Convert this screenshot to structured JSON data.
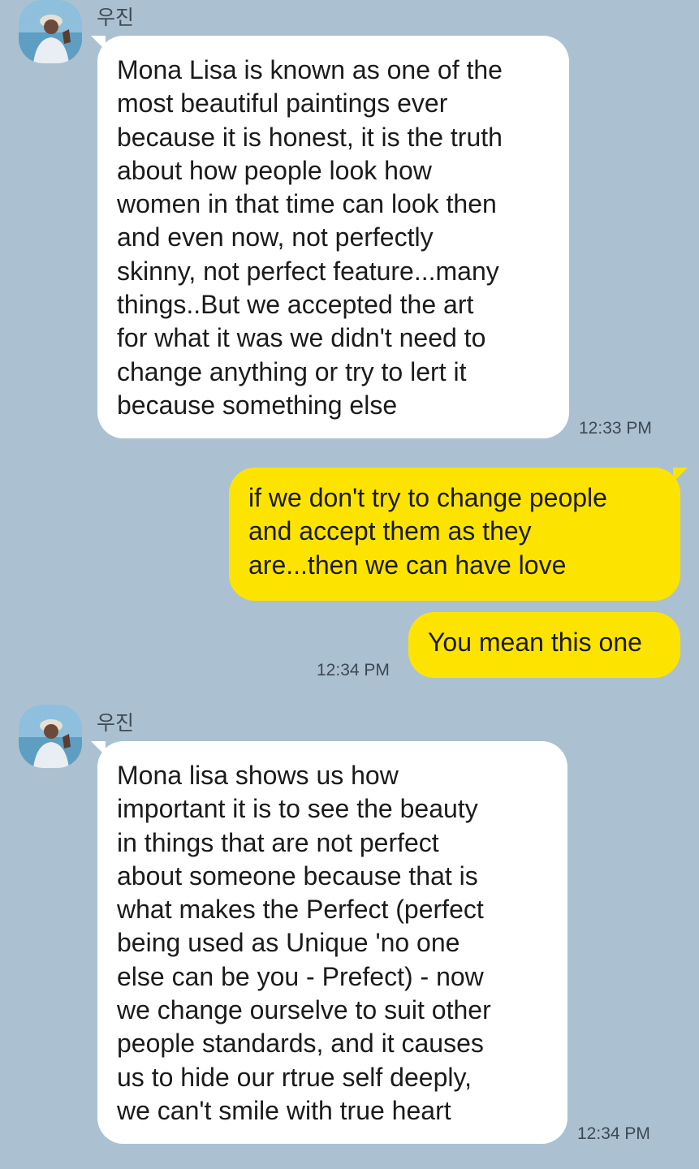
{
  "messages": [
    {
      "direction": "incoming",
      "sender": "우진",
      "text": "Mona Lisa is known as one of the\nmost beautiful paintings ever\nbecause it is honest, it is the truth\nabout how people look how\nwomen in that time can look then\nand even now, not perfectly\nskinny, not perfect feature...many\nthings..But we accepted the art\nfor what it was we didn't need to\nchange anything or try to lert it\nbecause something else",
      "time": "12:33 PM"
    },
    {
      "direction": "outgoing",
      "text": "if we don't try to change people\nand accept them as they\nare...then we can have love",
      "time": ""
    },
    {
      "direction": "outgoing",
      "text": "You mean this one",
      "time": "12:34 PM"
    },
    {
      "direction": "incoming",
      "sender": "우진",
      "text": "Mona lisa shows us how\nimportant it is to see the beauty\nin things that are not perfect\nabout someone because that is\nwhat makes the Perfect (perfect\nbeing used as Unique 'no one\nelse can be you - Prefect)   - now\nwe change ourselve to suit other\npeople standards, and it causes\nus to hide our rtrue self deeply,\nwe can't smile with true heart",
      "time": "12:34 PM"
    }
  ],
  "colors": {
    "background": "#abc1d1",
    "incoming_bubble": "#ffffff",
    "outgoing_bubble": "#fde400"
  },
  "icons": {
    "avatar": "profile-photo-avatar"
  }
}
